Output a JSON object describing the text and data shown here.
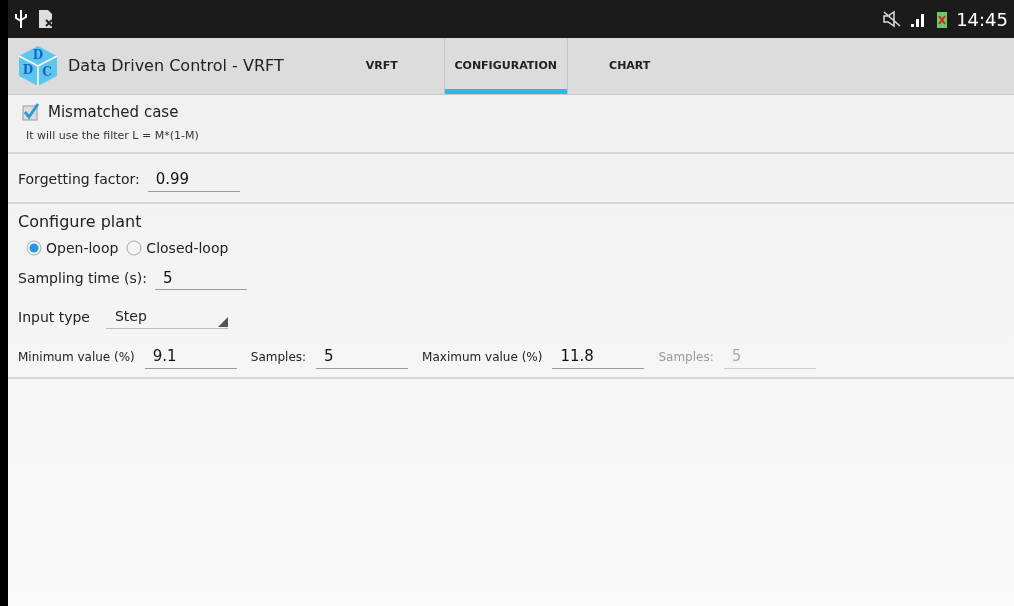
{
  "status_bar": {
    "time": "14:45"
  },
  "app": {
    "title": "Data Driven Control - VRFT",
    "logo_letters": [
      "D",
      "D",
      "C"
    ]
  },
  "tabs": [
    {
      "label": "VRFT",
      "selected": false
    },
    {
      "label": "CONFIGURATION",
      "selected": true
    },
    {
      "label": "CHART",
      "selected": false
    }
  ],
  "mismatch": {
    "label": "Mismatched case",
    "checked": true,
    "note": "It will use the filter L = M*(1-M)"
  },
  "forgetting": {
    "label": "Forgetting factor:",
    "value": "0.99"
  },
  "plant": {
    "heading": "Configure plant",
    "loop_options": [
      {
        "label": "Open-loop",
        "selected": true
      },
      {
        "label": "Closed-loop",
        "selected": false
      }
    ],
    "sampling": {
      "label": "Sampling time (s):",
      "value": "5"
    },
    "input_type": {
      "label": "Input type",
      "value": "Step"
    },
    "range_fields": [
      {
        "label": "Minimum value (%)",
        "value": "9.1",
        "disabled": false
      },
      {
        "label": "Samples:",
        "value": "5",
        "disabled": false
      },
      {
        "label": "Maximum value (%)",
        "value": "11.8",
        "disabled": false
      },
      {
        "label": "Samples:",
        "value": "5",
        "disabled": true
      }
    ]
  }
}
